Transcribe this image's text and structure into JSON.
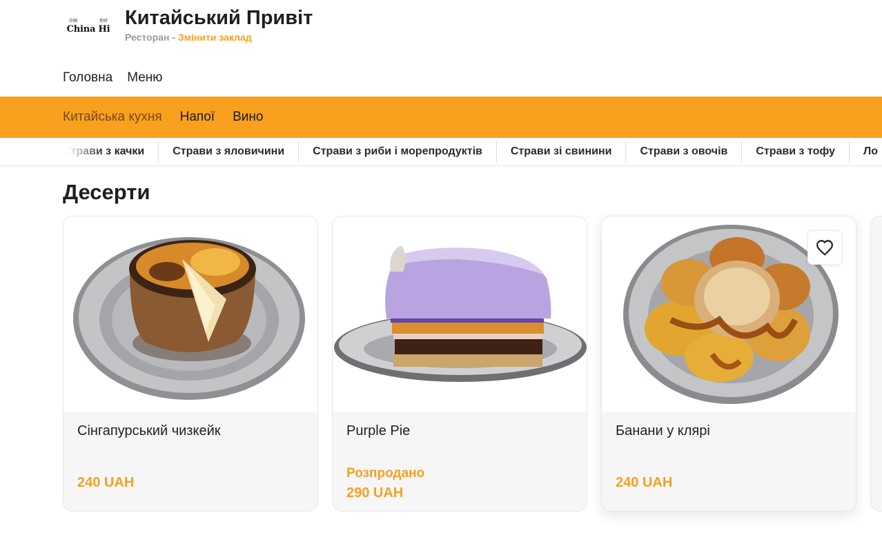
{
  "header": {
    "logo_text": "China Hi",
    "logo_small_left": "中国",
    "logo_small_right": "你好",
    "title": "Китайський Привіт",
    "subtitle_prefix": "Ресторан",
    "subtitle_separator": " - ",
    "change_link": "Змінити заклад"
  },
  "topnav": {
    "items": [
      "Головна",
      "Меню"
    ]
  },
  "categories": {
    "items": [
      "Китайська кухня",
      "Напої",
      "Вино"
    ],
    "active_index": 0
  },
  "subcategories": {
    "items": [
      "Страви з качки",
      "Страви з яловичини",
      "Страви з риби і морепродуктів",
      "Страви зі свинини",
      "Страви з овочів",
      "Страви з тофу",
      "Ло"
    ]
  },
  "section": {
    "title": "Десерти"
  },
  "products": [
    {
      "name": "Сінгапурський чизкейк",
      "status": "",
      "price": "240 UAH"
    },
    {
      "name": "Purple Pie",
      "status": "Розпродано",
      "price": "290 UAH"
    },
    {
      "name": "Банани у клярі",
      "status": "",
      "price": "240 UAH"
    }
  ],
  "icons": {
    "favorite": "heart-outline-icon"
  },
  "colors": {
    "accent": "#f9a01f",
    "price": "#f5a024",
    "active_category": "#7a4a16"
  }
}
